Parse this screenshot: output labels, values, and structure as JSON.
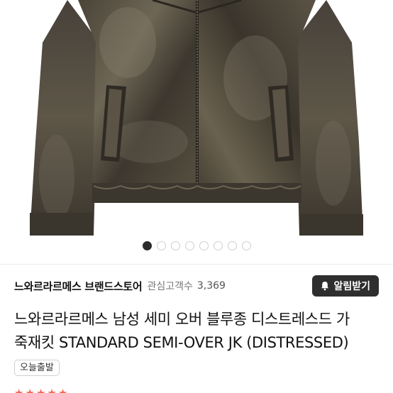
{
  "product_image": {
    "alt": "",
    "pager": {
      "count": 8,
      "active_index": 0
    }
  },
  "store": {
    "name": "느와르라르메스 브랜드스토어",
    "fav_label": "관심고객수",
    "fav_count": "3,369",
    "alarm_label": "알림받기",
    "alarm_icon": "bell-plus-icon"
  },
  "product": {
    "title_line1": "느와르라르메스 남성 세미 오버 블루종 디스트레스드 가",
    "title_line2": "죽재킷 STANDARD SEMI-OVER JK (DISTRESSED)",
    "badge": "오늘출발"
  },
  "rating": {
    "stars": 5
  },
  "colors": {
    "alarm_bg": "#2e2e2e",
    "star": "#f26450",
    "active_dot": "#2b2b2b"
  }
}
